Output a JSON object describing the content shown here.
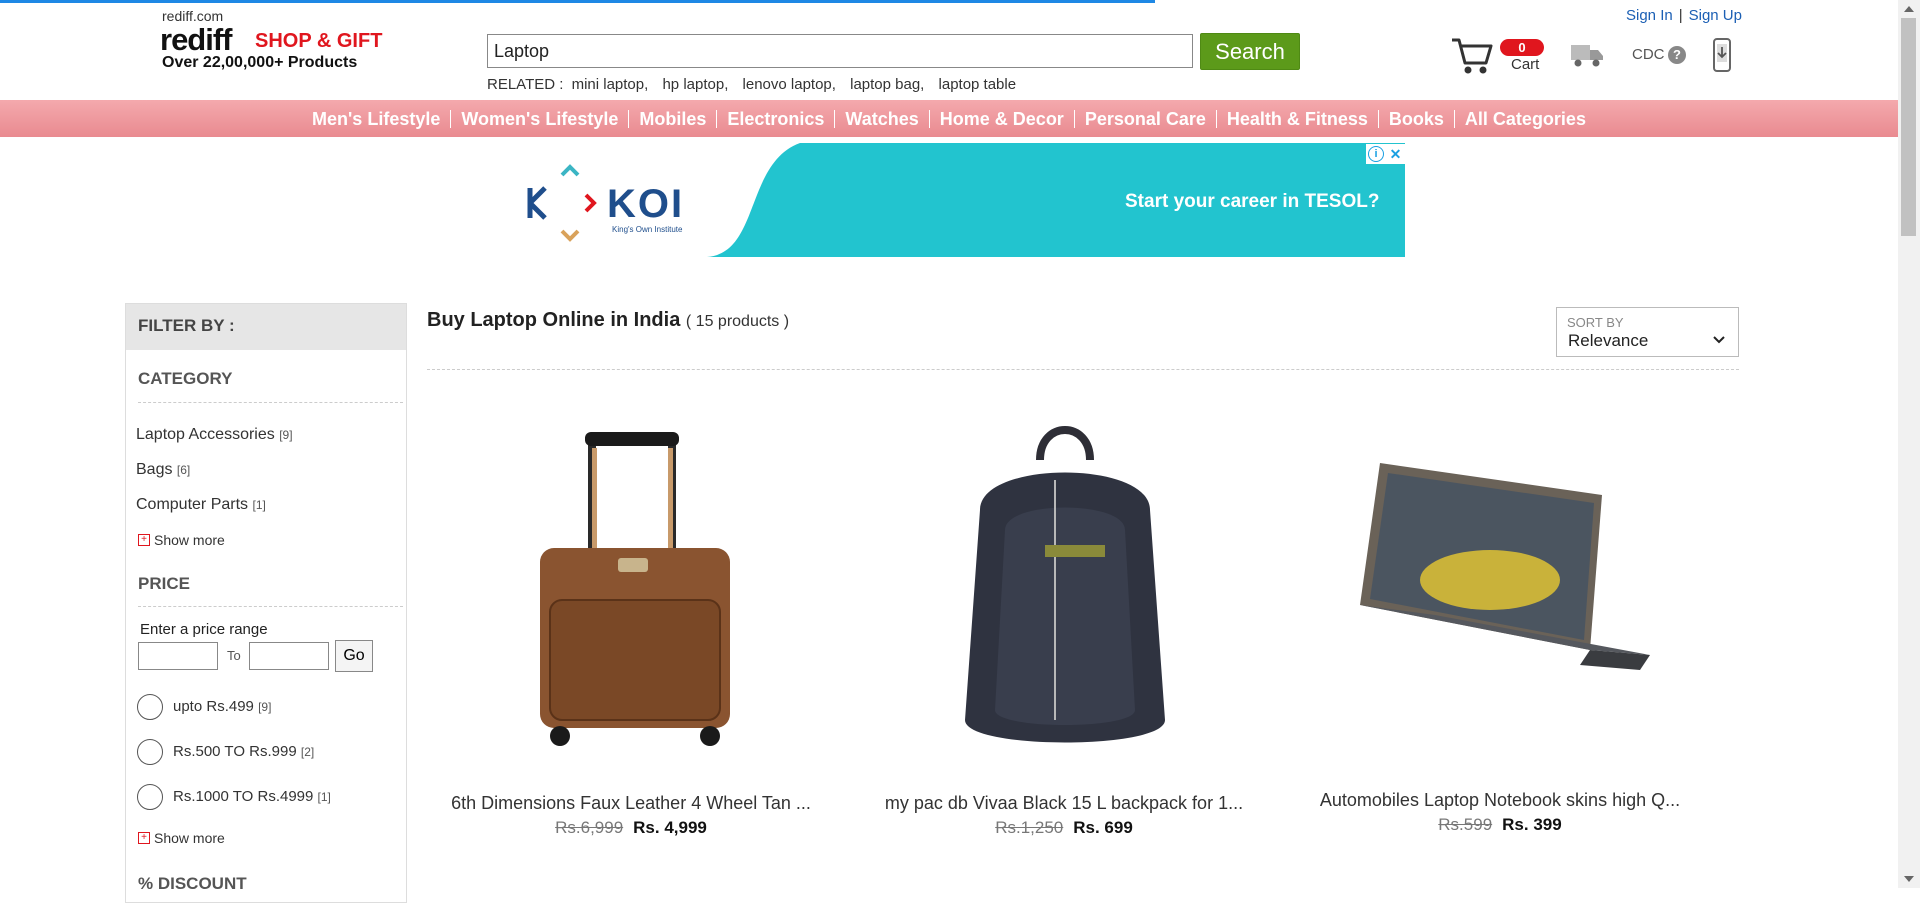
{
  "header": {
    "site_small": "rediff.com",
    "logo_main": "rediff",
    "logo_tag": "SHOP & GIFT",
    "logo_sub": "Over 22,00,000+ Products",
    "search_value": "Laptop",
    "search_button": "Search",
    "related_prefix": "RELATED :",
    "related": [
      "mini laptop,",
      "hp laptop,",
      "lenovo laptop,",
      "laptop bag,",
      "laptop table"
    ],
    "cart_count": "0",
    "cart_label": "Cart",
    "cdc_label": "CDC",
    "help_glyph": "?",
    "sign_in": "Sign In",
    "separator": "|",
    "sign_up": "Sign Up"
  },
  "nav": [
    "Men's Lifestyle",
    "Women's Lifestyle",
    "Mobiles",
    "Electronics",
    "Watches",
    "Home & Decor",
    "Personal Care",
    "Health & Fitness",
    "Books",
    "All Categories"
  ],
  "banner": {
    "brand": "KOI",
    "brand_sub": "King's Own Institute",
    "text": "Start your career in TESOL?",
    "adchoice_glyph": "i",
    "close_glyph": "✕"
  },
  "sidebar": {
    "filter_title": "FILTER BY :",
    "category_title": "CATEGORY",
    "categories": [
      {
        "label": "Laptop Accessories",
        "count": "[9]"
      },
      {
        "label": "Bags",
        "count": "[6]"
      },
      {
        "label": "Computer Parts",
        "count": "[1]"
      }
    ],
    "show_more": "Show more",
    "plus_glyph": "+",
    "price_title": "PRICE",
    "price_range_label": "Enter a price range",
    "to_label": "To",
    "go_label": "Go",
    "price_options": [
      {
        "label": "upto Rs.499",
        "count": "[9]"
      },
      {
        "label": "Rs.500 TO Rs.999",
        "count": "[2]"
      },
      {
        "label": "Rs.1000 TO Rs.4999",
        "count": "[1]"
      }
    ],
    "discount_title": "% DISCOUNT"
  },
  "main": {
    "title": "Buy Laptop Online in India",
    "count": "( 15 products )",
    "sort_label": "SORT BY",
    "sort_value": "Relevance",
    "products": [
      {
        "title": "6th Dimensions Faux Leather 4 Wheel Tan ...",
        "old_price": "Rs.6,999",
        "price": "Rs. 4,999"
      },
      {
        "title": "my pac db Vivaa Black 15 L backpack for 1...",
        "old_price": "Rs.1,250",
        "price": "Rs. 699"
      },
      {
        "title": "Automobiles Laptop Notebook skins high Q...",
        "old_price": "Rs.599",
        "price": "Rs. 399"
      }
    ]
  },
  "colors": {
    "brand_red": "#e0161e",
    "search_green": "#5c9a1a",
    "nav_pink": "#e98a90",
    "banner_teal": "#22c4cf",
    "link_blue": "#1b5fb4"
  }
}
